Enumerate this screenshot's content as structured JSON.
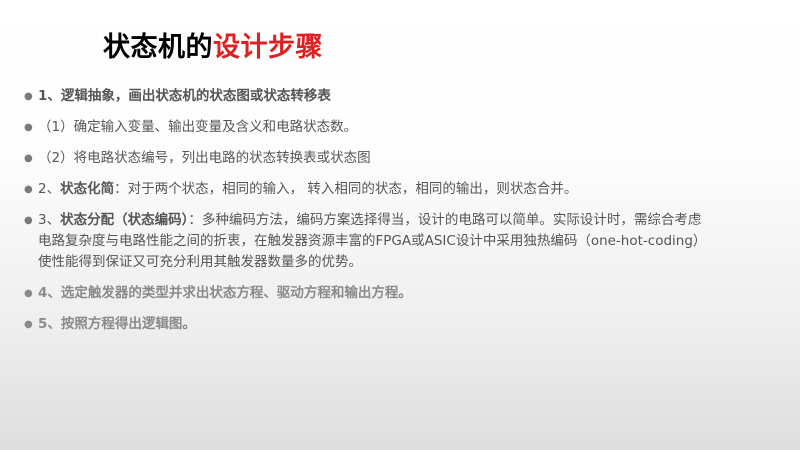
{
  "title": {
    "part_a": "状态机的",
    "part_b": "设计步骤"
  },
  "bullets": [
    {
      "lead": "1、",
      "bold": "逻辑抽象，画出状态机的状态图或状态转移表",
      "rest": ""
    },
    {
      "lead": "（1）确定输入变量、输出变量及含义和电路状态数。",
      "bold": "",
      "rest": ""
    },
    {
      "lead": "（2）将电路状态编号，列出电路的状态转换表或状态图",
      "bold": "",
      "rest": ""
    },
    {
      "lead": "2、",
      "bold": "状态化简",
      "rest": "：对于两个状态，相同的输入， 转入相同的状态，相同的输出，则状态合并。"
    },
    {
      "lead": "3、",
      "bold": "状态分配（状态编码）",
      "rest": "：多种编码方法，编码方案选择得当，设计的电路可以简单。实际设计时，需综合考虑电路复杂度与电路性能之间的折衷，在触发器资源丰富的FPGA或ASIC设计中采用独热编码（one-hot-coding）使性能得到保证又可充分利用其触发器数量多的优势。"
    },
    {
      "lead": "4、选定触发器的类型并求出状态方程、驱动方程和输出方程。",
      "bold": "",
      "rest": ""
    },
    {
      "lead": "5、按照方程得出逻辑图。",
      "bold": "",
      "rest": ""
    }
  ],
  "icons": {
    "bullet": "bullet-dot-icon",
    "bullet_glyph": "●"
  },
  "colors": {
    "title_black": "#000000",
    "title_red": "#e02020",
    "body_text": "#555555",
    "muted_text": "#8a8a8a"
  }
}
